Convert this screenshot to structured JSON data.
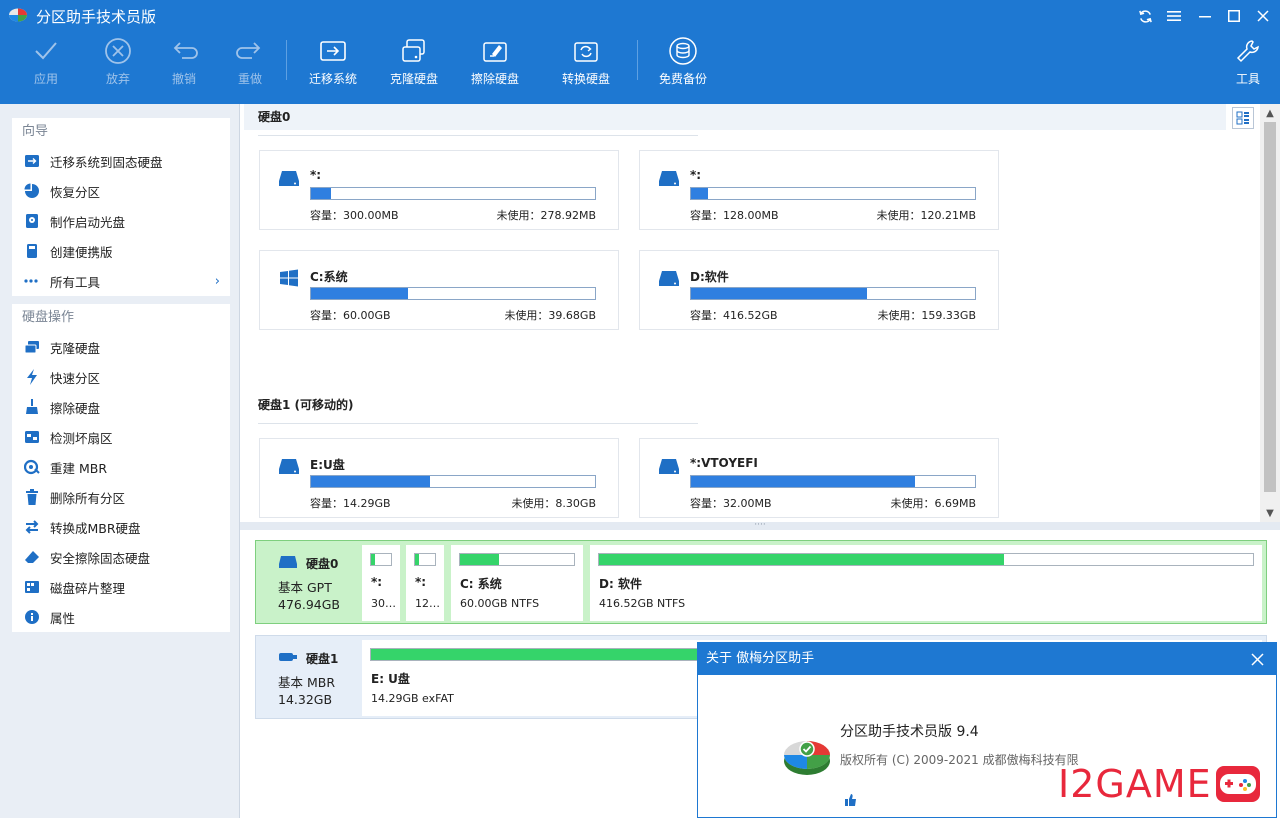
{
  "window": {
    "title": "分区助手技术员版"
  },
  "toolbar": {
    "apply": "应用",
    "discard": "放弃",
    "undo": "撤销",
    "redo": "重做",
    "migrate": "迁移系统",
    "clone": "克隆硬盘",
    "wipe": "擦除硬盘",
    "convert": "转换硬盘",
    "backup": "免费备份",
    "tools": "工具"
  },
  "sidebar": {
    "wizard_title": "向导",
    "wizard_items": [
      {
        "label": "迁移系统到固态硬盘",
        "icon": "migrate-ssd-icon"
      },
      {
        "label": "恢复分区",
        "icon": "recover-pie-icon"
      },
      {
        "label": "制作启动光盘",
        "icon": "boot-disc-icon"
      },
      {
        "label": "创建便携版",
        "icon": "portable-icon"
      },
      {
        "label": "所有工具",
        "icon": "more-dots-icon"
      }
    ],
    "ops_title": "硬盘操作",
    "ops_items": [
      {
        "label": "克隆硬盘",
        "icon": "clone-disk-icon"
      },
      {
        "label": "快速分区",
        "icon": "lightning-icon"
      },
      {
        "label": "擦除硬盘",
        "icon": "broom-icon"
      },
      {
        "label": "检测坏扇区",
        "icon": "scan-icon"
      },
      {
        "label": "重建 MBR",
        "icon": "rebuild-icon"
      },
      {
        "label": "删除所有分区",
        "icon": "trash-icon"
      },
      {
        "label": "转换成MBR硬盘",
        "icon": "convert-icon"
      },
      {
        "label": "安全擦除固态硬盘",
        "icon": "eraser-icon"
      },
      {
        "label": "磁盘碎片整理",
        "icon": "defrag-icon"
      },
      {
        "label": "属性",
        "icon": "info-icon"
      }
    ]
  },
  "disk0": {
    "header": "硬盘0",
    "partitions": [
      {
        "name": "*:",
        "capacity": "容量：300.00MB",
        "free": "未使用：278.92MB",
        "used_frac": 0.07,
        "icon": "drive-icon"
      },
      {
        "name": "*:",
        "capacity": "容量：128.00MB",
        "free": "未使用：120.21MB",
        "used_frac": 0.06,
        "icon": "drive-icon"
      },
      {
        "name": "C:系统",
        "capacity": "容量：60.00GB",
        "free": "未使用：39.68GB",
        "used_frac": 0.34,
        "icon": "windows-icon"
      },
      {
        "name": "D:软件",
        "capacity": "容量：416.52GB",
        "free": "未使用：159.33GB",
        "used_frac": 0.62,
        "icon": "drive-icon"
      }
    ]
  },
  "disk1": {
    "header": "硬盘1 (可移动的)",
    "partitions": [
      {
        "name": "E:U盘",
        "capacity": "容量：14.29GB",
        "free": "未使用：8.30GB",
        "used_frac": 0.42,
        "icon": "drive-icon"
      },
      {
        "name": "*:VTOYEFI",
        "capacity": "容量：32.00MB",
        "free": "未使用：6.69MB",
        "used_frac": 0.79,
        "icon": "drive-icon"
      }
    ]
  },
  "diskmap": {
    "splitter": "····",
    "disk0": {
      "name": "硬盘0",
      "type": "基本 GPT",
      "size": "476.94GB",
      "segments": [
        {
          "name": "*:",
          "info": "30…",
          "used_frac": 0.2
        },
        {
          "name": "*:",
          "info": "12…",
          "used_frac": 0.2
        },
        {
          "name": "C: 系统",
          "info": "60.00GB NTFS",
          "used_frac": 0.34
        },
        {
          "name": "D: 软件",
          "info": "416.52GB NTFS",
          "used_frac": 0.62
        }
      ]
    },
    "disk1": {
      "name": "硬盘1",
      "type": "基本 MBR",
      "size": "14.32GB",
      "segments": [
        {
          "name": "E: U盘",
          "info": "14.29GB exFAT",
          "used_frac": 0.42
        }
      ]
    }
  },
  "about": {
    "title": "关于 傲梅分区助手",
    "product": "分区助手技术员版 9.4",
    "copyright": "版权所有 (C) 2009-2021 成都傲梅科技有限"
  },
  "watermark": {
    "text": "I2GAME"
  },
  "colors": {
    "titlebar": "#1e78d2",
    "accent": "#1f6fc5",
    "used_bar": "#2f7fe0",
    "map_bar": "#35d46a",
    "selected_row": "#c9f2c9"
  }
}
